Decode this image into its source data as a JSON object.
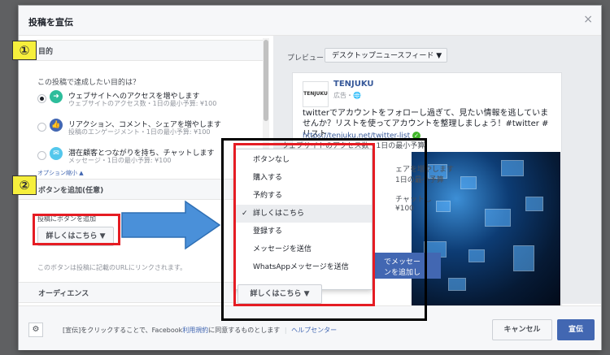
{
  "modal": {
    "title": "投稿を宣伝",
    "close": "×"
  },
  "badges": {
    "one": "①",
    "two": "②"
  },
  "goal_section": {
    "heading": "目的",
    "question": "この投稿で達成したい目的は？",
    "options": [
      {
        "title": "ウェブサイトへのアクセスを増やします",
        "sub": "ウェブサイトのアクセス数・1日の最小予算: ¥100",
        "color": "#2dbd9b"
      },
      {
        "title": "リアクション、コメント、シェアを増やします",
        "sub": "投稿のエンゲージメント・1日の最小予算: ¥100",
        "color": "#4267b2"
      },
      {
        "title": "潜在顧客とつながりを持ち、チャットします",
        "sub": "メッセージ・1日の最小予算: ¥100",
        "color": "#54c7ec"
      }
    ],
    "options_toggle": "オプション縮小 ▲"
  },
  "button_section": {
    "heading": "ボタンを追加(任意)",
    "label": "投稿にボタンを追加",
    "selected": "詳しくはこちら ▼",
    "note": "このボタンは投稿に記載のURLにリンクされます。"
  },
  "audience_section": {
    "heading": "オーディエンス"
  },
  "preview": {
    "label": "プレビュー：",
    "select": "デスクトップニュースフィード ▼",
    "logo_text": "TENJUKU",
    "page_name": "TENJUKU",
    "meta": "広告・🌐",
    "text": "twitterでアカウントをフォローし過ぎて、見たい情報を逃していませんか？リストを使ってアカウントを整理しましょう！#twitter #リスト",
    "link": "https://tenjuku.net/twitter-list",
    "check": "✓",
    "underlay_lines": [
      "ウェブサイトのアクセス数・1日の最小予算",
      "ェアを増やします",
      "1日の最小予算",
      "チャットし",
      "¥100"
    ],
    "cta_lines": [
      "でメッセー",
      "ンを追加し"
    ]
  },
  "dropdown": {
    "items": [
      "ボタンなし",
      "購入する",
      "予約する",
      "詳しくはこちら",
      "登録する",
      "メッセージを送信",
      "WhatsAppメッセージを送信"
    ],
    "selected_index": 3,
    "tick": "✓",
    "button": "詳しくはこちら ▼"
  },
  "footer": {
    "gear": "⚙",
    "text_before": "[宣伝]をクリックすることで、Facebook",
    "terms": "利用規約",
    "text_after": "に同意するものとします",
    "separator": "|",
    "help": "ヘルプセンター",
    "cancel": "キャンセル",
    "boost": "宣伝"
  },
  "colors": {
    "accent": "#4267b2",
    "highlight_red": "#e51c23",
    "badge_yellow": "#f6ef3c",
    "arrow_blue": "#4a90d9"
  }
}
